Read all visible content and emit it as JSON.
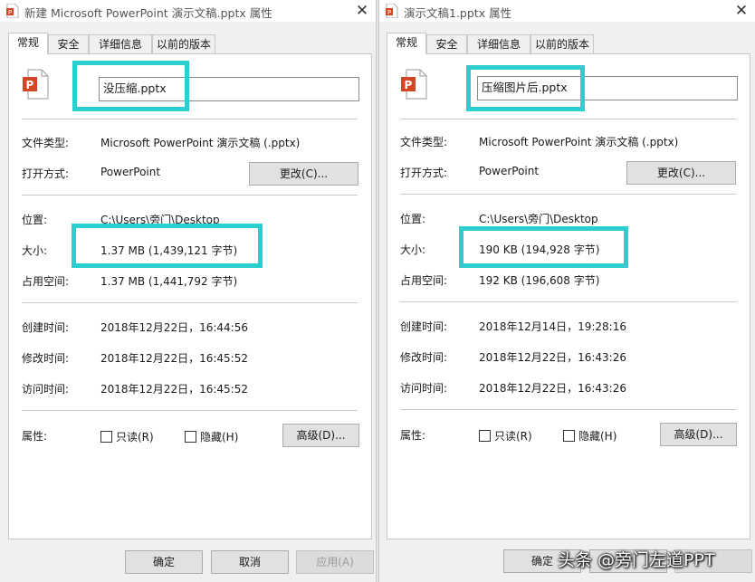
{
  "left": {
    "title": "新建 Microsoft PowerPoint 演示文稿.pptx 属性",
    "tabs": [
      "常规",
      "安全",
      "详细信息",
      "以前的版本"
    ],
    "file_name": "没压缩.pptx",
    "rows": {
      "type_label": "文件类型:",
      "type_value": "Microsoft PowerPoint 演示文稿 (.pptx)",
      "open_label": "打开方式:",
      "open_value": "PowerPoint",
      "change_button": "更改(C)...",
      "location_label": "位置:",
      "location_value": "C:\\Users\\旁门\\Desktop",
      "size_label": "大小:",
      "size_value": "1.37 MB (1,439,121 字节)",
      "disk_label": "占用空间:",
      "disk_value": "1.37 MB (1,441,792 字节)",
      "created_label": "创建时间:",
      "created_value": "2018年12月22日，16:44:56",
      "modified_label": "修改时间:",
      "modified_value": "2018年12月22日，16:45:52",
      "accessed_label": "访问时间:",
      "accessed_value": "2018年12月22日，16:45:52",
      "attr_label": "属性:",
      "readonly": "只读(R)",
      "hidden": "隐藏(H)",
      "advanced_button": "高级(D)..."
    },
    "footer": {
      "ok": "确定",
      "cancel": "取消",
      "apply": "应用(A)"
    }
  },
  "right": {
    "title": "演示文稿1.pptx 属性",
    "tabs": [
      "常规",
      "安全",
      "详细信息",
      "以前的版本"
    ],
    "file_name": "压缩图片后.pptx",
    "rows": {
      "type_label": "文件类型:",
      "type_value": "Microsoft PowerPoint 演示文稿 (.pptx)",
      "open_label": "打开方式:",
      "open_value": "PowerPoint",
      "change_button": "更改(C)...",
      "location_label": "位置:",
      "location_value": "C:\\Users\\旁门\\Desktop",
      "size_label": "大小:",
      "size_value": "190 KB (194,928 字节)",
      "disk_label": "占用空间:",
      "disk_value": "192 KB (196,608 字节)",
      "created_label": "创建时间:",
      "created_value": "2018年12月14日，19:28:16",
      "modified_label": "修改时间:",
      "modified_value": "2018年12月22日，16:43:26",
      "accessed_label": "访问时间:",
      "accessed_value": "2018年12月22日，16:43:26",
      "attr_label": "属性:",
      "readonly": "只读(R)",
      "hidden": "隐藏(H)",
      "advanced_button": "高级(D)..."
    },
    "footer": {
      "ok": "确定"
    }
  },
  "watermark": "头条 @旁门左道PPT",
  "colors": {
    "highlight": "#2ad0d0",
    "ppt_red": "#d24726"
  }
}
